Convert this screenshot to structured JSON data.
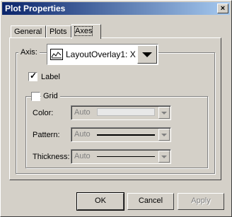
{
  "window": {
    "title": "Plot Properties",
    "close": "×"
  },
  "tabs": [
    {
      "label": "General",
      "active": false
    },
    {
      "label": "Plots",
      "active": false
    },
    {
      "label": "Axes",
      "active": true
    }
  ],
  "axes": {
    "axis_label": "Axis:",
    "axis_value": "LayoutOverlay1: X",
    "label_checkbox": {
      "label": "Label",
      "checked": true
    },
    "grid": {
      "checkbox_label": "Grid",
      "checked": false,
      "color": {
        "label": "Color:",
        "value": "Auto"
      },
      "pattern": {
        "label": "Pattern:",
        "value": "Auto"
      },
      "thickness": {
        "label": "Thickness:",
        "value": "Auto"
      }
    }
  },
  "buttons": {
    "ok": "OK",
    "cancel": "Cancel",
    "apply": "Apply"
  },
  "colors": {
    "titlebar_start": "#0a246a",
    "titlebar_end": "#a6caf0",
    "face": "#d4d0c8"
  },
  "icons": {
    "close": "close-icon",
    "plot": "line-plot-icon",
    "dropdown": "chevron-down-icon"
  }
}
